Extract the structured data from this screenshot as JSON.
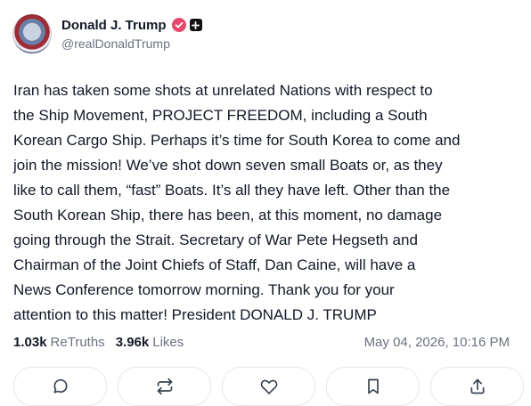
{
  "author": {
    "display_name": "Donald J. Trump",
    "handle": "@realDonaldTrump"
  },
  "post": {
    "text": "Iran has taken some shots at unrelated Nations with respect to\nthe Ship Movement, PROJECT FREEDOM, including a South\nKorean Cargo Ship. Perhaps it’s time for South Korea to come and\njoin the mission! We’ve shot down seven small Boats or, as they\nlike to call them, “fast” Boats. It’s all they have left. Other than the\nSouth Korean Ship, there has been, at this moment, no damage\ngoing through the Strait. Secretary of War Pete Hegseth and\nChairman of the Joint Chiefs of Staff, Dan Caine, will have a\nNews Conference tomorrow morning. Thank you for your\nattention to this matter! President DONALD J. TRUMP"
  },
  "stats": {
    "retruths_count": "1.03k",
    "retruths_label": "ReTruths",
    "likes_count": "3.96k",
    "likes_label": "Likes",
    "timestamp": "May 04, 2026, 10:16 PM"
  },
  "icons": {
    "verified": "verified-badge-icon",
    "plus": "plus-icon",
    "reply": "comment-icon",
    "retruth": "repost-icon",
    "like": "heart-icon",
    "bookmark": "bookmark-icon",
    "share": "share-icon"
  },
  "colors": {
    "verified_badge": "#e8476b",
    "text": "#111827",
    "muted": "#6b7280",
    "border": "#e5e7eb"
  }
}
